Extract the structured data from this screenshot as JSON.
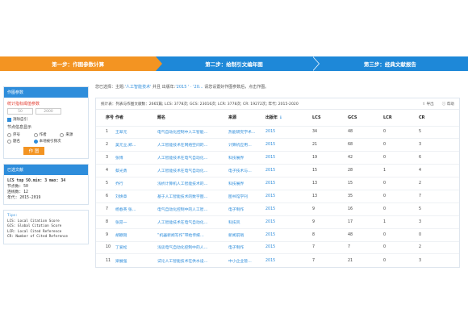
{
  "steps": [
    "第一步：作图参数计算",
    "第二步：绘制引文编年图",
    "第三步：经典文献报告"
  ],
  "params": {
    "title": "作图参数",
    "hint": "统计指标阈值参数",
    "input1_value": "50",
    "input2_value": "2000",
    "checkbox_label": "消除自引",
    "node_title": "节点信息显示",
    "options": [
      "序号",
      "作者",
      "来源",
      "题名",
      "本地被引频次"
    ],
    "button_label": "作 图"
  },
  "selected": {
    "title": "已选文献",
    "lines": [
      "LCS top 50.min: 3  max: 34",
      "节点数: 50",
      "连线数: 12",
      "年代: 2015-2019"
    ]
  },
  "tips": {
    "title": "Tips:",
    "lines": [
      "LCS: Local Citation Score",
      "GCS: Global Citation Score",
      "LCR: Local Cited Reference",
      "CR: Number of Cited Reference"
    ]
  },
  "crumb": {
    "prefix": "您已选择：主题:",
    "topic": "'人工智能技术'",
    "mid": "并且 出版年:",
    "years": "'2015 ' · '20...",
    "suffix": "请您设置好作图参数后，点击作图。"
  },
  "info": {
    "text": "统计表：列表与作图文献数：2665篇; LCS: 3778次; GCS: 23016次; LCR: 3778次; CR: 19272次; 年代: 2015-2020",
    "export": "导出",
    "help": "帮助"
  },
  "table": {
    "headers": [
      "序号",
      "作者",
      "题名",
      "来源",
      "出版年",
      "LCS",
      "GCS",
      "LCR",
      "CR"
    ],
    "rows": [
      [
        "1",
        "王翠元",
        "电气自动化控制中人工智能…",
        "热能研究学术…",
        "2015",
        "34",
        "48",
        "0",
        "5"
      ],
      [
        "2",
        "吴元立,郑…",
        "人工智能技术在网络空间的…",
        "计算机应用…",
        "2015",
        "21",
        "68",
        "0",
        "3"
      ],
      [
        "3",
        "张博",
        "人工智能技术在电气自动化…",
        "科技展界",
        "2015",
        "19",
        "42",
        "0",
        "6"
      ],
      [
        "4",
        "蔡光勇",
        "人工智能技术在电气自动化…",
        "电子技术与…",
        "2015",
        "15",
        "28",
        "1",
        "4"
      ],
      [
        "5",
        "乔行",
        "浅析计算机人工智能技术的…",
        "科技展界",
        "2015",
        "13",
        "15",
        "0",
        "2"
      ],
      [
        "6",
        "刘焕章",
        "基于人工智能技术的数字图…",
        "图书馆学刊",
        "2015",
        "13",
        "35",
        "0",
        "7"
      ],
      [
        "7",
        "杨春英 张…",
        "电气自动化控制中的人工智…",
        "电子制作",
        "2015",
        "9",
        "16",
        "0",
        "5"
      ],
      [
        "8",
        "张昂一",
        "人工智能技术在电气自动化…",
        "科技风",
        "2015",
        "9",
        "17",
        "1",
        "3"
      ],
      [
        "9",
        "胡颖刚",
        "“机器新闻写作”带给传媒…",
        "新闻前哨",
        "2015",
        "8",
        "48",
        "0",
        "0"
      ],
      [
        "10",
        "丁爱松",
        "浅谈电气自动化控制中的人…",
        "电子制作",
        "2015",
        "7",
        "7",
        "0",
        "2"
      ],
      [
        "11",
        "梁展强",
        "试论人工智能技术在供水设…",
        "中小企业管…",
        "2015",
        "7",
        "21",
        "0",
        "3"
      ]
    ]
  }
}
